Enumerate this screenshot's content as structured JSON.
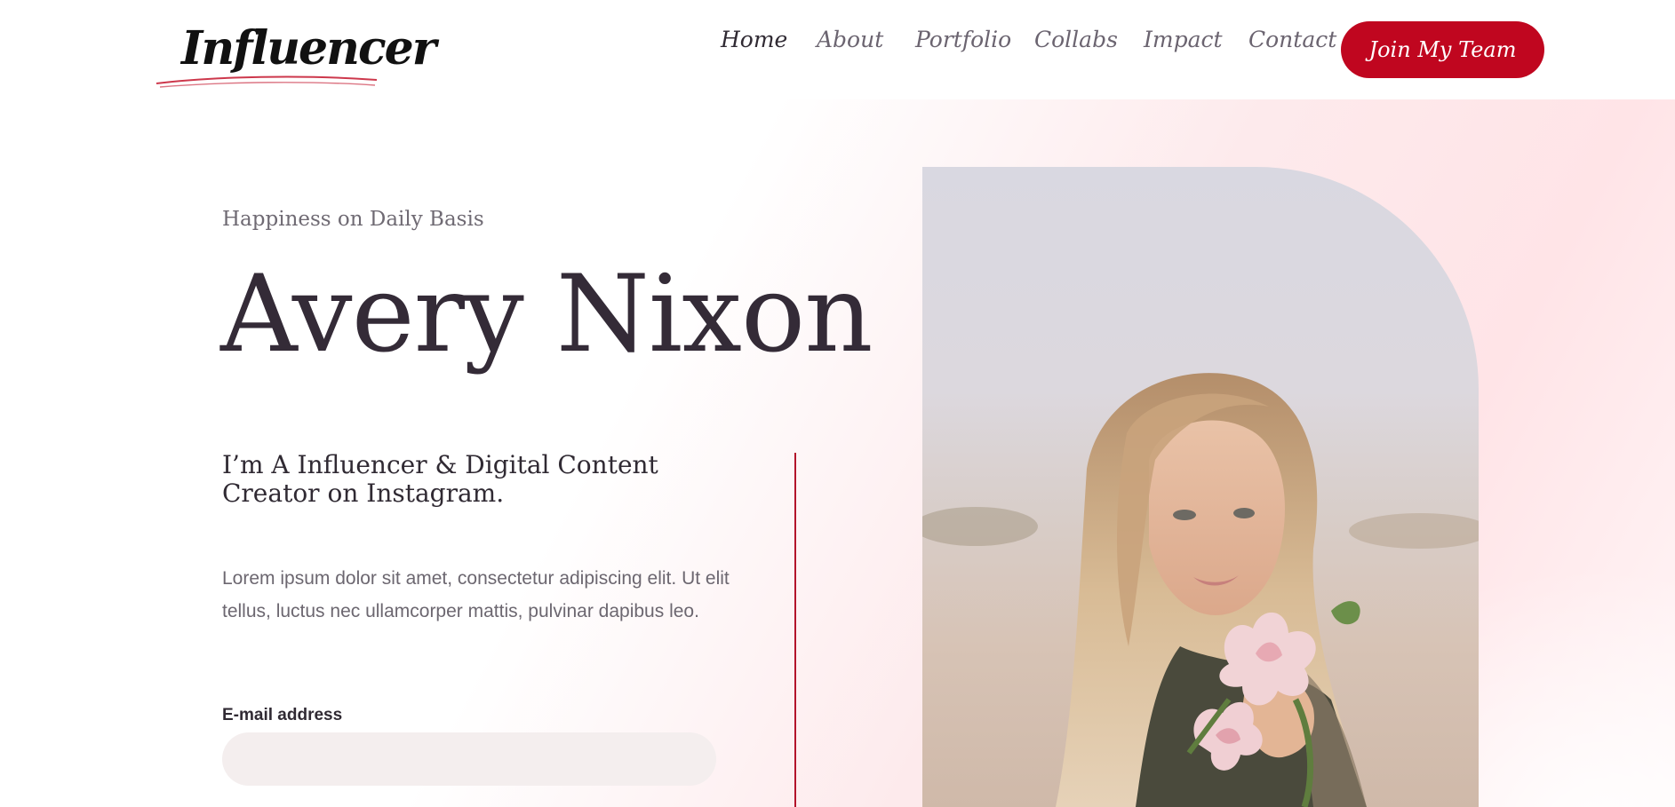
{
  "header": {
    "logo_text": "Influencer",
    "nav": [
      {
        "label": "Home",
        "active": true
      },
      {
        "label": "About",
        "active": false
      },
      {
        "label": "Portfolio",
        "active": false
      },
      {
        "label": "Collabs",
        "active": false
      },
      {
        "label": "Impact",
        "active": false
      },
      {
        "label": "Contact",
        "active": false
      }
    ],
    "cta_label": "Join My Team"
  },
  "hero": {
    "kicker": "Happiness on Daily Basis",
    "title": "Avery Nixon",
    "tagline": "I’m A Influencer & Digital Content Creator on Instagram.",
    "body": "Lorem ipsum dolor sit amet, consectetur adipiscing elit. Ut elit tellus, luctus nec ullamcorper mattis, pulvinar dapibus leo.",
    "email_label": "E-mail address",
    "email_value": "",
    "email_placeholder": ""
  },
  "colors": {
    "accent": "#c0061f",
    "heading": "#342b37",
    "body_text": "#6c6770",
    "input_bg": "#f4eeee"
  }
}
